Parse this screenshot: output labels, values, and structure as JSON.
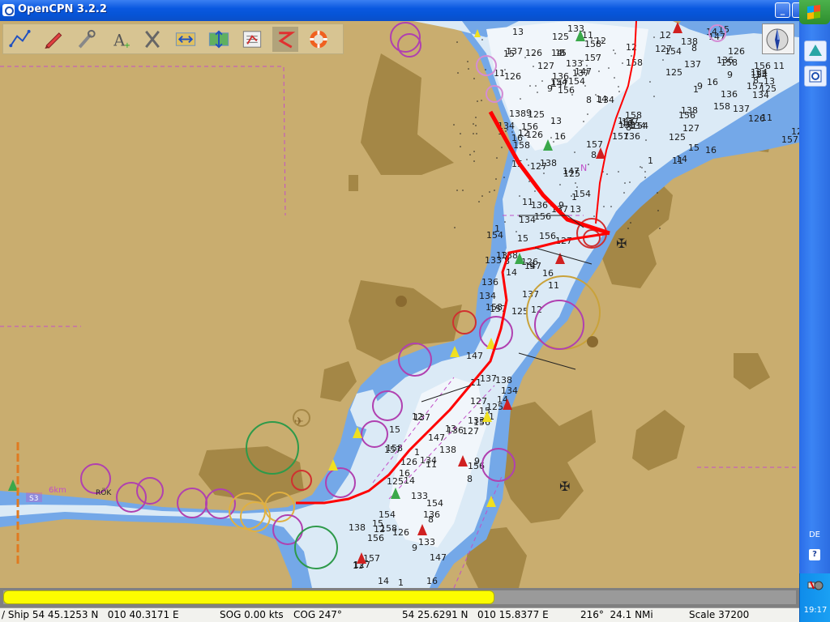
{
  "window": {
    "title": "OpenCPN 3.2.2",
    "minimize_glyph": "_",
    "maximize_glyph": ""
  },
  "toolbar": {
    "buttons": [
      {
        "name": "route-icon",
        "tooltip": ""
      },
      {
        "name": "ship-icon",
        "tooltip": ""
      },
      {
        "name": "settings-wrench-icon",
        "tooltip": ""
      },
      {
        "name": "text-toggle-icon",
        "tooltip": ""
      },
      {
        "name": "current-icon",
        "tooltip": ""
      },
      {
        "name": "zoom-in-icon",
        "tooltip": ""
      },
      {
        "name": "zoom-out-icon",
        "tooltip": ""
      },
      {
        "name": "route-manager-icon",
        "tooltip": ""
      },
      {
        "name": "track-icon",
        "tooltip": ""
      },
      {
        "name": "mob-icon",
        "tooltip": ""
      }
    ],
    "active_index": 8
  },
  "progress": {
    "fraction": 0.62
  },
  "status": {
    "ship": "/ Ship 54 45.1253 N   010 40.3171 E",
    "sog": "SOG 0.00 kts",
    "cog": "COG 247°",
    "cursor": "54 25.6291 N   010 15.8377 E",
    "bearing": "216°  24.1 NMi",
    "scale": "Scale 37200"
  },
  "taskbar": {
    "language": "DE",
    "help": "?",
    "clock": "19:17"
  },
  "chart": {
    "depths": [
      "156",
      "157",
      "158",
      "15",
      "16",
      "154",
      "147",
      "14",
      "13",
      "134",
      "133",
      "136",
      "137",
      "138",
      "126",
      "125",
      "127",
      "12",
      "11",
      "1",
      "9",
      "8"
    ],
    "labels": [
      "RÖK",
      "S3",
      "6km",
      "N"
    ],
    "colors": {
      "land": "#c9ad6f",
      "built": "#a48746",
      "shallow": "#74a8e8",
      "deep": "#dbeaf6",
      "deepest": "#f1f6fb",
      "route": "#ff0000",
      "magenta": "#c24fc8"
    }
  }
}
